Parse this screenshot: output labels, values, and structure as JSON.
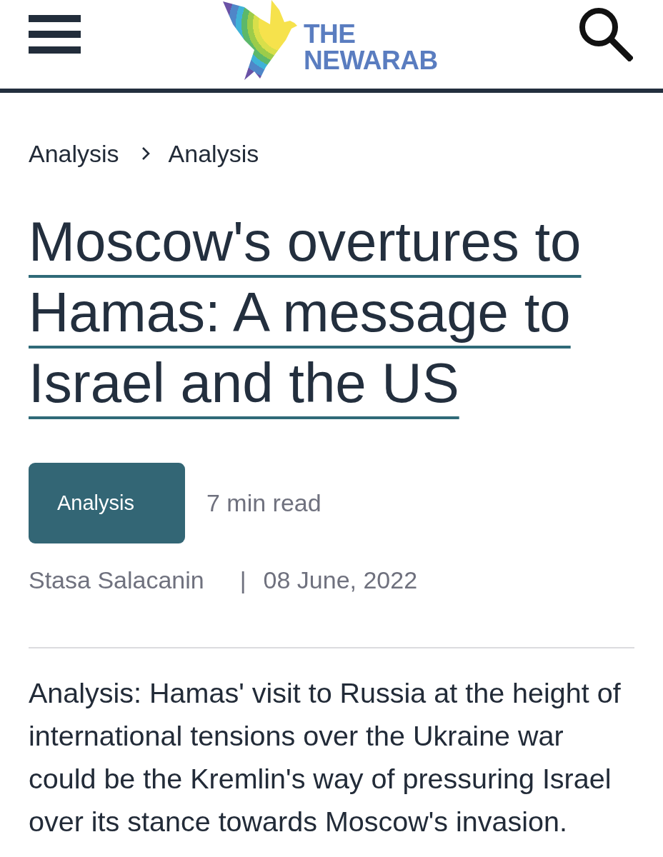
{
  "header": {
    "logo": {
      "lines": [
        "THE",
        "NEWARAB"
      ]
    }
  },
  "breadcrumb": [
    {
      "label": "Analysis"
    },
    {
      "label": "Analysis"
    }
  ],
  "article": {
    "title": "Moscow's overtures to Hamas: A message to Israel and the US",
    "category": "Analysis",
    "read_time": "7 min read",
    "author": "Stasa Salacanin",
    "separator": "|",
    "date": "08 June, 2022",
    "summary": "Analysis: Hamas' visit to Russia at the height of international tensions over the Ukraine war could be the Kremlin's way of pressuring Israel over its stance towards Moscow's invasion."
  }
}
